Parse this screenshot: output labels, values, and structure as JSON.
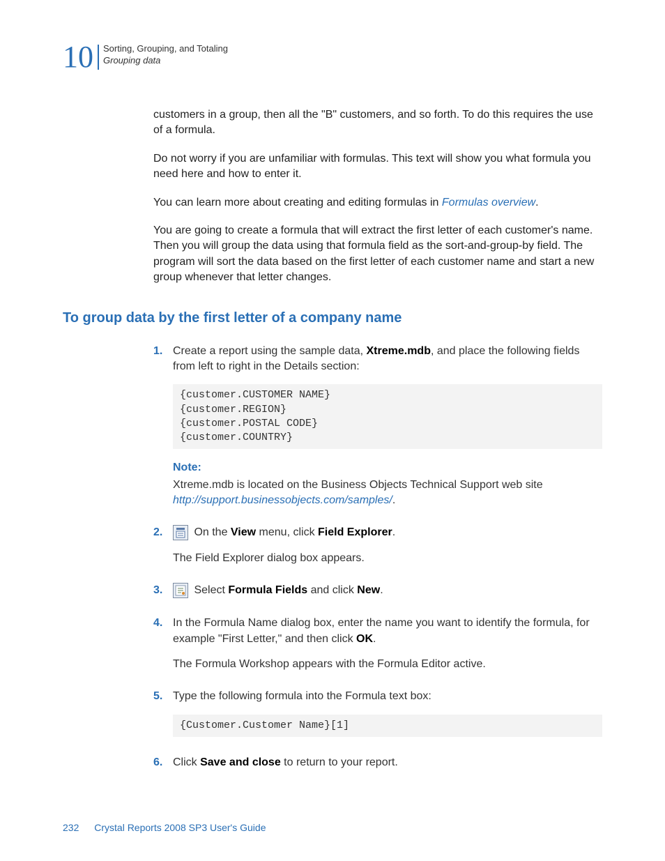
{
  "header": {
    "chapter_number": "10",
    "line1": "Sorting, Grouping, and Totaling",
    "line2": "Grouping data"
  },
  "intro": {
    "p1": "customers in a group, then all the \"B\" customers, and so forth. To do this requires the use of a formula.",
    "p2": "Do not worry if you are unfamiliar with formulas. This text will show you what formula you need here and how to enter it.",
    "p3_pre": "You can learn more about creating and editing formulas in ",
    "p3_link": "Formulas overview",
    "p3_post": ".",
    "p4": "You are going to create a formula that will extract the first letter of each customer's name. Then you will group the data using that formula field as the sort-and-group-by field. The program will sort the data based on the first letter of each customer name and start a new group whenever that letter changes."
  },
  "section_heading": "To group data by the first letter of a company name",
  "steps": {
    "s1_num": "1.",
    "s1_pre": "Create a report using the sample data, ",
    "s1_bold": "Xtreme.mdb",
    "s1_post": ", and place the following fields from left to right in the Details section:",
    "s1_code": "{customer.CUSTOMER NAME}\n{customer.REGION}\n{customer.POSTAL CODE}\n{customer.COUNTRY}",
    "note_label": "Note:",
    "note_pre": "Xtreme.mdb is located on the Business Objects Technical Support web site ",
    "note_link": "http://support.businessobjects.com/samples/",
    "note_post": ".",
    "s2_num": "2.",
    "s2_pre": " On the ",
    "s2_b1": "View",
    "s2_mid": " menu, click ",
    "s2_b2": "Field Explorer",
    "s2_post": ".",
    "s2_after": "The Field Explorer dialog box appears.",
    "s3_num": "3.",
    "s3_pre": " Select ",
    "s3_b1": "Formula Fields",
    "s3_mid": " and click ",
    "s3_b2": "New",
    "s3_post": ".",
    "s4_num": "4.",
    "s4_pre": "In the Formula Name dialog box, enter the name you want to identify the formula, for example \"First Letter,\" and then click ",
    "s4_b1": "OK",
    "s4_post": ".",
    "s4_after": "The Formula Workshop appears with the Formula Editor active.",
    "s5_num": "5.",
    "s5_text": "Type the following formula into the Formula text box:",
    "s5_code": "{Customer.Customer Name}[1]",
    "s6_num": "6.",
    "s6_pre": "Click ",
    "s6_b1": "Save and close",
    "s6_post": " to return to your report."
  },
  "footer": {
    "page_number": "232",
    "doc_title": "Crystal Reports 2008 SP3 User's Guide"
  }
}
